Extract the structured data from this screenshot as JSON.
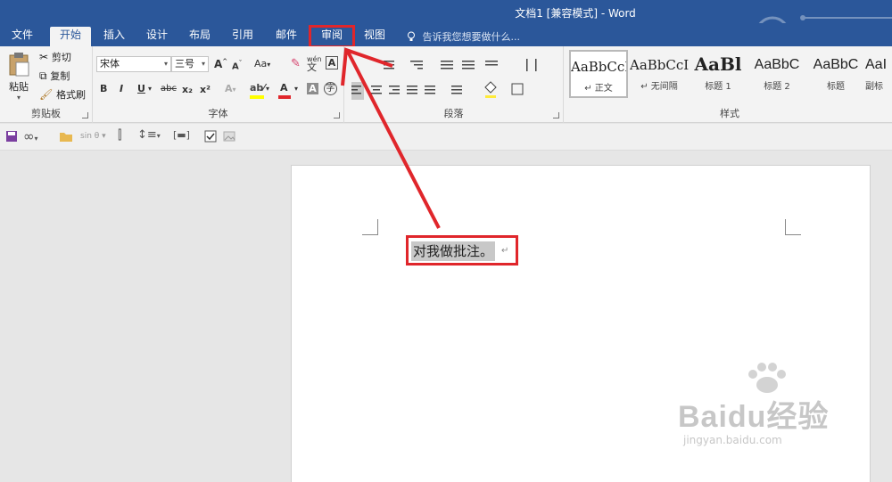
{
  "window": {
    "title": "文档1 [兼容模式] - Word"
  },
  "tabs": [
    {
      "label": "文件"
    },
    {
      "label": "开始"
    },
    {
      "label": "插入"
    },
    {
      "label": "设计"
    },
    {
      "label": "布局"
    },
    {
      "label": "引用"
    },
    {
      "label": "邮件"
    },
    {
      "label": "审阅"
    },
    {
      "label": "视图"
    }
  ],
  "tell_me": "告诉我您想要做什么...",
  "clipboard": {
    "paste_label": "粘贴",
    "cut_label": "剪切",
    "copy_label": "复制",
    "format_painter_label": "格式刷",
    "group_label": "剪贴板"
  },
  "font": {
    "font_name": "宋体",
    "font_size": "三号",
    "case_label": "Aa",
    "bold": "B",
    "italic": "I",
    "underline": "U",
    "strike": "abc",
    "subscript": "x₂",
    "superscript": "x²",
    "font_color_glyph": "A",
    "phonetic_glyph": "wén",
    "group_label": "字体"
  },
  "paragraph": {
    "group_label": "段落"
  },
  "styles": {
    "items": [
      {
        "sample": "AaBbCcI",
        "name": "↵ 正文"
      },
      {
        "sample": "AaBbCcI",
        "name": "↵ 无间隔"
      },
      {
        "sample": "AaBl",
        "name": "标题 1"
      },
      {
        "sample": "AaBbC",
        "name": "标题 2"
      },
      {
        "sample": "AaBbC",
        "name": "标题"
      },
      {
        "sample": "AaI",
        "name": "副标"
      }
    ],
    "group_label": "样式"
  },
  "quickbar": {
    "eq_label": "sin θ"
  },
  "document": {
    "text": "对我做批注。",
    "para_mark": "↵"
  },
  "watermark": {
    "brand": "Baidu经验",
    "url": "jingyan.baidu.com"
  },
  "colors": {
    "word_blue": "#2b579a",
    "highlight_red": "#e0262b"
  }
}
